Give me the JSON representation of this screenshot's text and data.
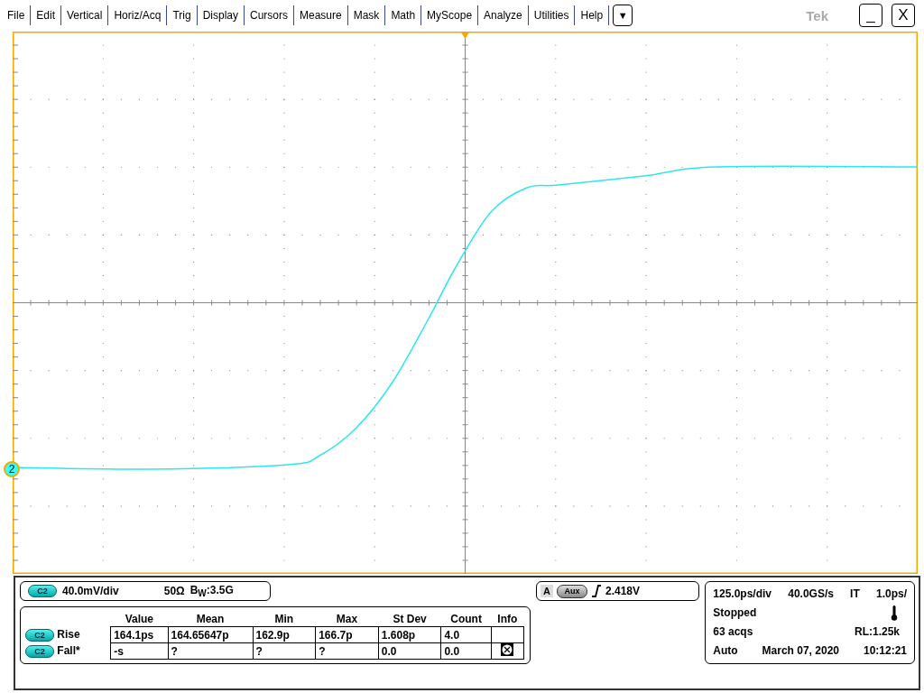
{
  "menu": {
    "items": [
      "File",
      "Edit",
      "Vertical",
      "Horiz/Acq",
      "Trig",
      "Display",
      "Cursors",
      "Measure",
      "Mask",
      "Math",
      "MyScope",
      "Analyze",
      "Utilities",
      "Help"
    ],
    "more": "▼",
    "brand": "Tek",
    "minimize": "_",
    "close": "X"
  },
  "display": {
    "channel_marker": "2"
  },
  "channel": {
    "badge": "C2",
    "scale": "40.0mV/div",
    "impedance": "50Ω",
    "bandwidth": "B$_{W}$:3.5G"
  },
  "trigger": {
    "letter": "A",
    "source": "Aux",
    "level": "2.418V"
  },
  "measurements": {
    "columns": [
      "Value",
      "Mean",
      "Min",
      "Max",
      "St Dev",
      "Count",
      "Info"
    ],
    "rows": [
      {
        "badge": "C2",
        "name": "Rise",
        "cells": [
          "164.1ps",
          "164.65647p",
          "162.9p",
          "166.7p",
          "1.608p",
          "4.0"
        ],
        "warning": false
      },
      {
        "badge": "C2",
        "name": "Fall*",
        "cells": [
          "-s",
          "?",
          "?",
          "?",
          "0.0",
          "0.0"
        ],
        "warning": true
      }
    ]
  },
  "timebase": {
    "scale": "125.0ps/div",
    "rate": "40.0GS/s",
    "mode": "IT",
    "resolution": "1.0ps/",
    "state": "Stopped",
    "acqs": "63 acqs",
    "record_length": "RL:1.25k",
    "trigger_mode": "Auto",
    "date": "March 07, 2020",
    "time": "10:12:21"
  }
}
